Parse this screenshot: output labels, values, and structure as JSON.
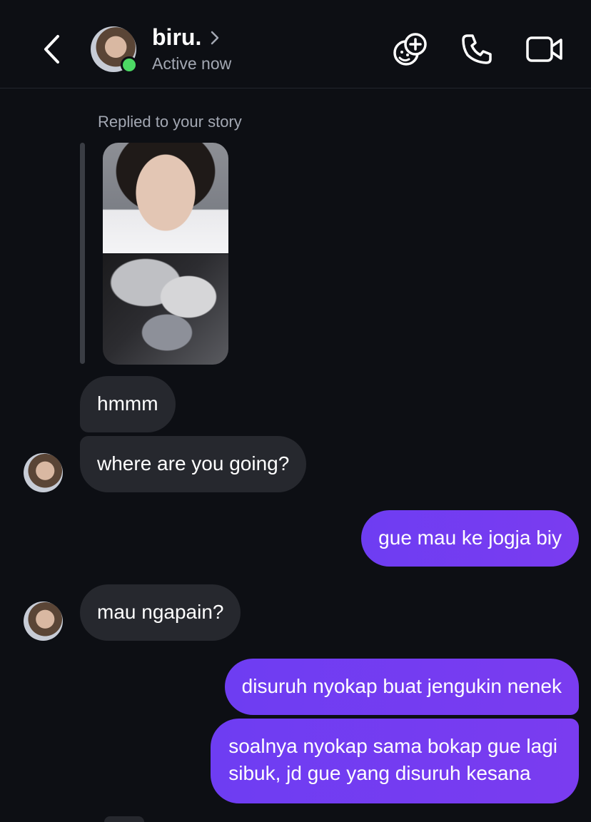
{
  "header": {
    "name": "biru.",
    "status": "Active now",
    "icons": {
      "back": "chevron-left-icon",
      "profile": "chevron-right-icon",
      "add_effect": "sticker-plus-icon",
      "call": "phone-icon",
      "video": "video-camera-icon"
    },
    "online_color": "#4cd964"
  },
  "thread": {
    "reply_label": "Replied to your story",
    "messages": [
      {
        "from": "them",
        "text": "hmmm"
      },
      {
        "from": "them",
        "text": "where are you going?"
      },
      {
        "from": "me",
        "text": "gue mau ke jogja biy"
      },
      {
        "from": "them",
        "text": "mau ngapain?"
      },
      {
        "from": "me",
        "text": "disuruh nyokap buat jengukin nenek"
      },
      {
        "from": "me",
        "lines": [
          "soalnya nyokap sama bokap gue lagi",
          "sibuk, jd gue yang disuruh kesana"
        ]
      }
    ]
  },
  "colors": {
    "background": "#0d0f14",
    "incoming_bubble": "#26282e",
    "outgoing_bubble": "#7b3cf0",
    "secondary_text": "#a3a8b3"
  }
}
